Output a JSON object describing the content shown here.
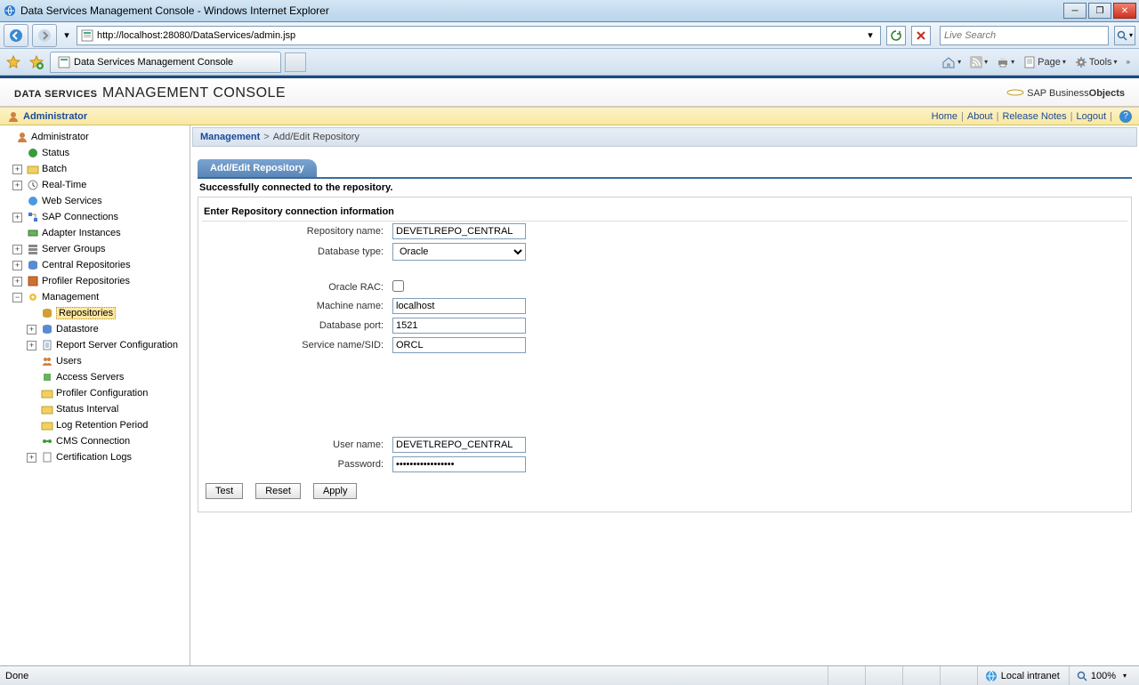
{
  "window": {
    "title": "Data Services Management Console - Windows Internet Explorer"
  },
  "address_bar": {
    "url": "http://localhost:28080/DataServices/admin.jsp"
  },
  "search": {
    "placeholder": "Live Search"
  },
  "tab": {
    "label": "Data Services Management Console"
  },
  "cmdbar": {
    "page": "Page",
    "tools": "Tools"
  },
  "console": {
    "title_strong": "DATA SERVICES",
    "title_rest": "MANAGEMENT CONSOLE",
    "brand_prefix": "SAP ",
    "brand_mid": "Business",
    "brand_suffix": "Objects"
  },
  "admin_strip": {
    "label": "Administrator",
    "links": {
      "home": "Home",
      "about": "About",
      "release": "Release Notes",
      "logout": "Logout"
    }
  },
  "tree": {
    "root": "Administrator",
    "status": "Status",
    "batch": "Batch",
    "realtime": "Real-Time",
    "web": "Web Services",
    "sapconn": "SAP Connections",
    "adapter": "Adapter Instances",
    "server": "Server Groups",
    "central": "Central Repositories",
    "profiler": "Profiler Repositories",
    "management": "Management",
    "repositories": "Repositories",
    "datastore": "Datastore",
    "reportsrv": "Report Server Configuration",
    "users": "Users",
    "access": "Access Servers",
    "profcfg": "Profiler Configuration",
    "statusint": "Status Interval",
    "logret": "Log Retention Period",
    "cms": "CMS Connection",
    "cert": "Certification Logs"
  },
  "breadcrumb": {
    "root": "Management",
    "current": "Add/Edit Repository"
  },
  "page": {
    "tab": "Add/Edit Repository",
    "success": "Successfully connected to the repository.",
    "section": "Enter Repository connection information",
    "labels": {
      "reponame": "Repository name:",
      "dbtype": "Database type:",
      "rac": "Oracle RAC:",
      "machine": "Machine name:",
      "port": "Database port:",
      "sid": "Service name/SID:",
      "user": "User name:",
      "password": "Password:"
    },
    "values": {
      "reponame": "DEVETLREPO_CENTRAL",
      "dbtype": "Oracle",
      "machine": "localhost",
      "port": "1521",
      "sid": "ORCL",
      "user": "DEVETLREPO_CENTRAL",
      "password": "•••••••••••••••••"
    },
    "buttons": {
      "test": "Test",
      "reset": "Reset",
      "apply": "Apply"
    }
  },
  "statusbar": {
    "done": "Done",
    "zone": "Local intranet",
    "zoom": "100%"
  }
}
